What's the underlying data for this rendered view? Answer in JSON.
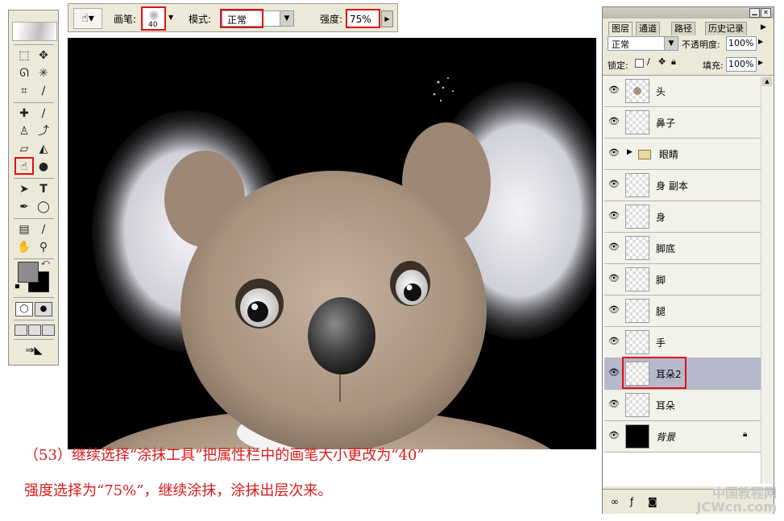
{
  "options_bar": {
    "brush_label": "画笔:",
    "brush_size": "40",
    "mode_label": "模式:",
    "mode_value": "正常",
    "strength_label": "强度:",
    "strength_value": "75%"
  },
  "layers_panel": {
    "tabs": [
      "图层",
      "通道",
      "路径",
      "历史记录"
    ],
    "blend_mode": "正常",
    "opacity_label": "不透明度:",
    "opacity_value": "100%",
    "lock_label": "锁定:",
    "fill_label": "填充:",
    "fill_value": "100%",
    "layers": [
      {
        "name": "头"
      },
      {
        "name": "鼻子"
      },
      {
        "name": "眼睛"
      },
      {
        "name": "身 副本"
      },
      {
        "name": "身"
      },
      {
        "name": "脚底"
      },
      {
        "name": "脚"
      },
      {
        "name": "腿"
      },
      {
        "name": "手"
      },
      {
        "name": "耳朵2"
      },
      {
        "name": "耳朵"
      },
      {
        "name": "背景"
      }
    ]
  },
  "caption": {
    "line1": "（53）继续选择“涂抹工具”把属性栏中的画笔大小更改为“40”",
    "line2": "强度选择为“75%”，继续涂抹，涂抹出层次来。"
  },
  "watermark": "中国教程网 JCWcn.com",
  "colors": {
    "highlight": "#e01010",
    "caption": "#d81a1a",
    "selected_layer": "#b6b8cc"
  }
}
